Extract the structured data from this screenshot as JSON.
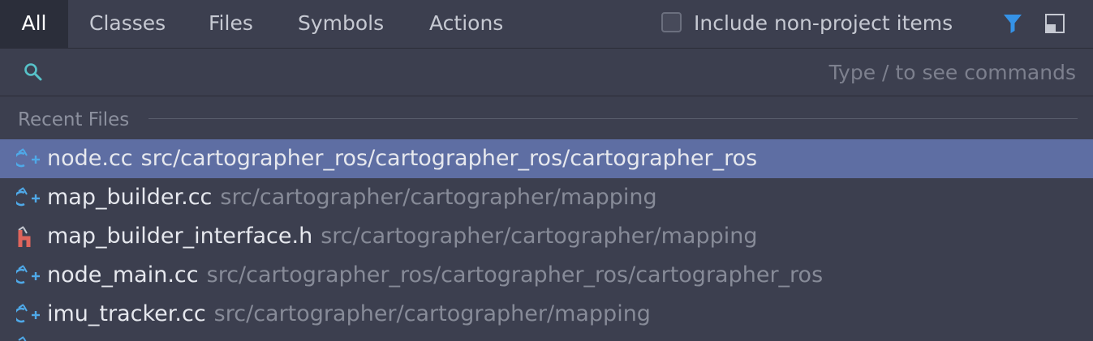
{
  "tabs": [
    {
      "label": "All",
      "active": true
    },
    {
      "label": "Classes"
    },
    {
      "label": "Files"
    },
    {
      "label": "Symbols"
    },
    {
      "label": "Actions"
    }
  ],
  "options": {
    "include_label": "Include non-project items",
    "include_checked": false,
    "filter_icon": "filter-icon",
    "layout_icon": "preview-panel-icon",
    "accent": "#3592e6"
  },
  "search": {
    "icon": "search-icon",
    "value": "",
    "placeholder": "Type / to see commands"
  },
  "section": {
    "title": "Recent Files"
  },
  "files": [
    {
      "name": "node.cc",
      "path": "src/cartographer_ros/cartographer_ros/cartographer_ros",
      "icon": "cpp-file-icon",
      "selected": true
    },
    {
      "name": "map_builder.cc",
      "path": "src/cartographer/cartographer/mapping",
      "icon": "cpp-file-icon"
    },
    {
      "name": "map_builder_interface.h",
      "path": "src/cartographer/cartographer/mapping",
      "icon": "header-file-icon"
    },
    {
      "name": "node_main.cc",
      "path": "src/cartographer_ros/cartographer_ros/cartographer_ros",
      "icon": "cpp-file-icon"
    },
    {
      "name": "imu_tracker.cc",
      "path": "src/cartographer/cartographer/mapping",
      "icon": "cpp-file-icon"
    }
  ],
  "colors": {
    "selected_row": "#5e6ea3",
    "cpp_icon": "#4fa9e8",
    "header_icon": "#e0655c"
  }
}
